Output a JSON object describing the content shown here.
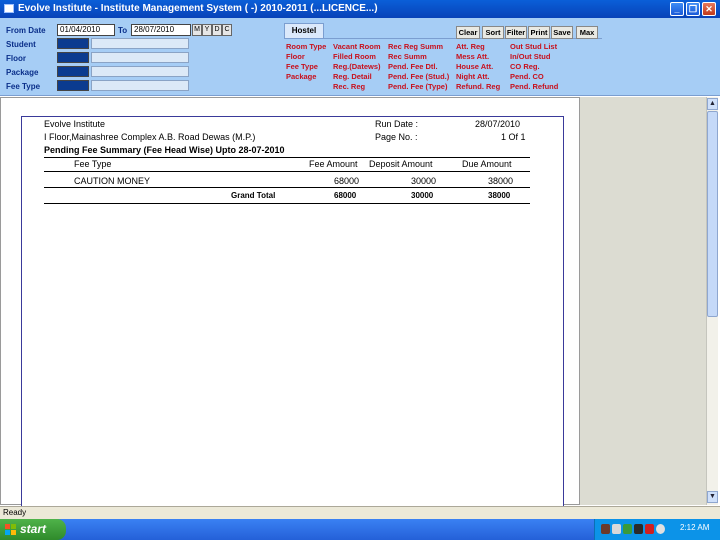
{
  "window": {
    "title": "Evolve Institute - Institute Management System ( -) 2010-2011 (...LICENCE...)",
    "controls": {
      "minimize": "_",
      "restore": "❐",
      "close": "✕"
    }
  },
  "filters": {
    "from_date_label": "From Date",
    "from_date_value": "01/04/2010",
    "to_label": "To",
    "to_date_value": "28/07/2010",
    "period_buttons": [
      "M",
      "Y",
      "D",
      "C"
    ],
    "fields": [
      "Student",
      "Floor",
      "Package",
      "Fee Type"
    ]
  },
  "tabs": {
    "active": "Hostel"
  },
  "actions": [
    "Clear",
    "Sort",
    "Filter",
    "Print",
    "Save",
    "Max"
  ],
  "report_links": {
    "col1": [
      "Room Type",
      "Floor",
      "Fee Type",
      "Package"
    ],
    "col2": [
      "Vacant Room",
      "Filled Room",
      "Reg.(Datews)",
      "Reg. Detail",
      "Rec. Reg"
    ],
    "col3": [
      "Rec Reg Summ",
      "Rec Summ",
      "Pend. Fee Dtl.",
      "Pend. Fee (Stud.)",
      "Pend. Fee (Type)"
    ],
    "col4": [
      "Att. Reg",
      "Mess Att.",
      "House Att.",
      "Night Att.",
      "Refund. Reg"
    ],
    "col5": [
      "Out Stud List",
      "In/Out Stud",
      "CO Reg.",
      "Pend. CO",
      "Pend. Refund"
    ]
  },
  "report": {
    "institute": "Evolve Institute",
    "address": "I Floor,Mainashree Complex A.B. Road Dewas (M.P.)",
    "run_date_label": "Run Date :",
    "run_date_value": "28/07/2010",
    "page_no_label": "Page No. :",
    "page_no_value": "1 Of 1",
    "heading": "Pending Fee Summary (Fee Head Wise) Upto 28-07-2010",
    "columns": [
      "Fee Type",
      "Fee Amount",
      "Deposit Amount",
      "Due Amount"
    ],
    "rows": [
      {
        "fee_type": "CAUTION MONEY",
        "fee_amount": "68000",
        "deposit_amount": "30000",
        "due_amount": "38000"
      }
    ],
    "total": {
      "label": "Grand Total",
      "fee_amount": "68000",
      "deposit_amount": "30000",
      "due_amount": "38000"
    }
  },
  "status": {
    "text": "Ready"
  },
  "taskbar": {
    "start_label": "start",
    "clock": "2:12 AM"
  }
}
